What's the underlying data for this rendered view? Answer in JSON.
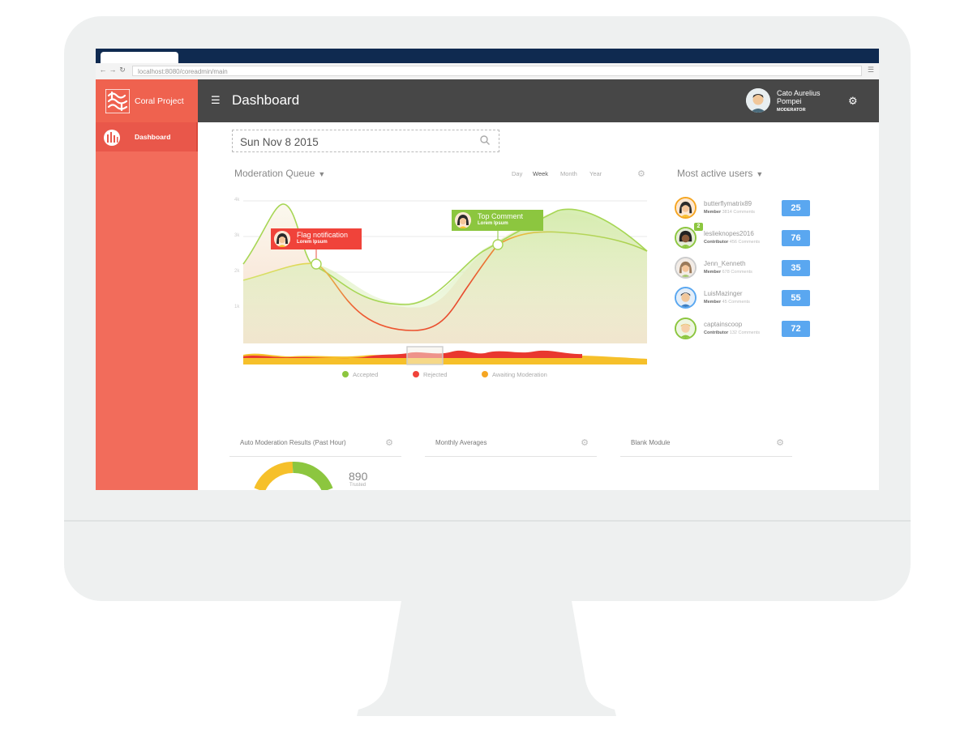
{
  "browser": {
    "url": "localhost:8080/coreadmin/main",
    "back": "←",
    "forward": "→",
    "reload": "↻",
    "menu": "☰"
  },
  "sidebar": {
    "logo_text": "Coral Project",
    "items": [
      {
        "label": "Dashboard",
        "active": true
      }
    ]
  },
  "header": {
    "title": "Dashboard",
    "menu_icon": "☰",
    "user_name": "Cato Aurelius Pompei",
    "user_role": "MODERATOR",
    "settings_icon": "⚙"
  },
  "date_picker": {
    "value": "Sun Nov 8 2015",
    "icon": "search-icon"
  },
  "moderation_queue": {
    "title": "Moderation Queue",
    "periods": [
      "Day",
      "Week",
      "Month",
      "Year"
    ],
    "active_period": "Week",
    "y_ticks": [
      "4k",
      "3k",
      "2k",
      "1k"
    ],
    "callouts": [
      {
        "title": "Flag notification",
        "subtitle": "Lorem Ipsum",
        "color": "#f0433a"
      },
      {
        "title": "Top Comment",
        "subtitle": "Lorem Ipsum",
        "color": "#8cc63f"
      }
    ],
    "legend": [
      {
        "label": "Accepted",
        "color": "#8cc63f"
      },
      {
        "label": "Rejected",
        "color": "#f0433a"
      },
      {
        "label": "Awaiting Moderation",
        "color": "#f5a623"
      }
    ]
  },
  "most_active_users": {
    "title": "Most active users",
    "users": [
      {
        "name": "butterflymatrix89",
        "role": "Member",
        "comments": "3814 Comments",
        "score": "25",
        "ring": "#f5a623"
      },
      {
        "name": "leslieknopes2016",
        "role": "Contributor",
        "comments": "456 Comments",
        "score": "76",
        "ring": "#8cc63f",
        "badge": "2"
      },
      {
        "name": "Jenn_Kenneth",
        "role": "Member",
        "comments": "678 Comments",
        "score": "35",
        "ring": "#cccccc"
      },
      {
        "name": "LuisMazinger",
        "role": "Member",
        "comments": "45 Comments",
        "score": "55",
        "ring": "#5aa7f0"
      },
      {
        "name": "captainscoop",
        "role": "Contributor",
        "comments": "132 Comments",
        "score": "72",
        "ring": "#8cc63f"
      }
    ]
  },
  "modules": [
    {
      "title": "Auto Moderation Results (Past Hour)"
    },
    {
      "title": "Monthly Averages"
    },
    {
      "title": "Blank Module"
    }
  ],
  "auto_moderation": {
    "value": "890",
    "label": "Trusted"
  },
  "colors": {
    "sidebar": "#f26c5b",
    "header": "#474747",
    "accent_blue": "#5aa7f0",
    "accepted": "#8cc63f",
    "rejected": "#f0433a",
    "awaiting": "#f5a623"
  }
}
